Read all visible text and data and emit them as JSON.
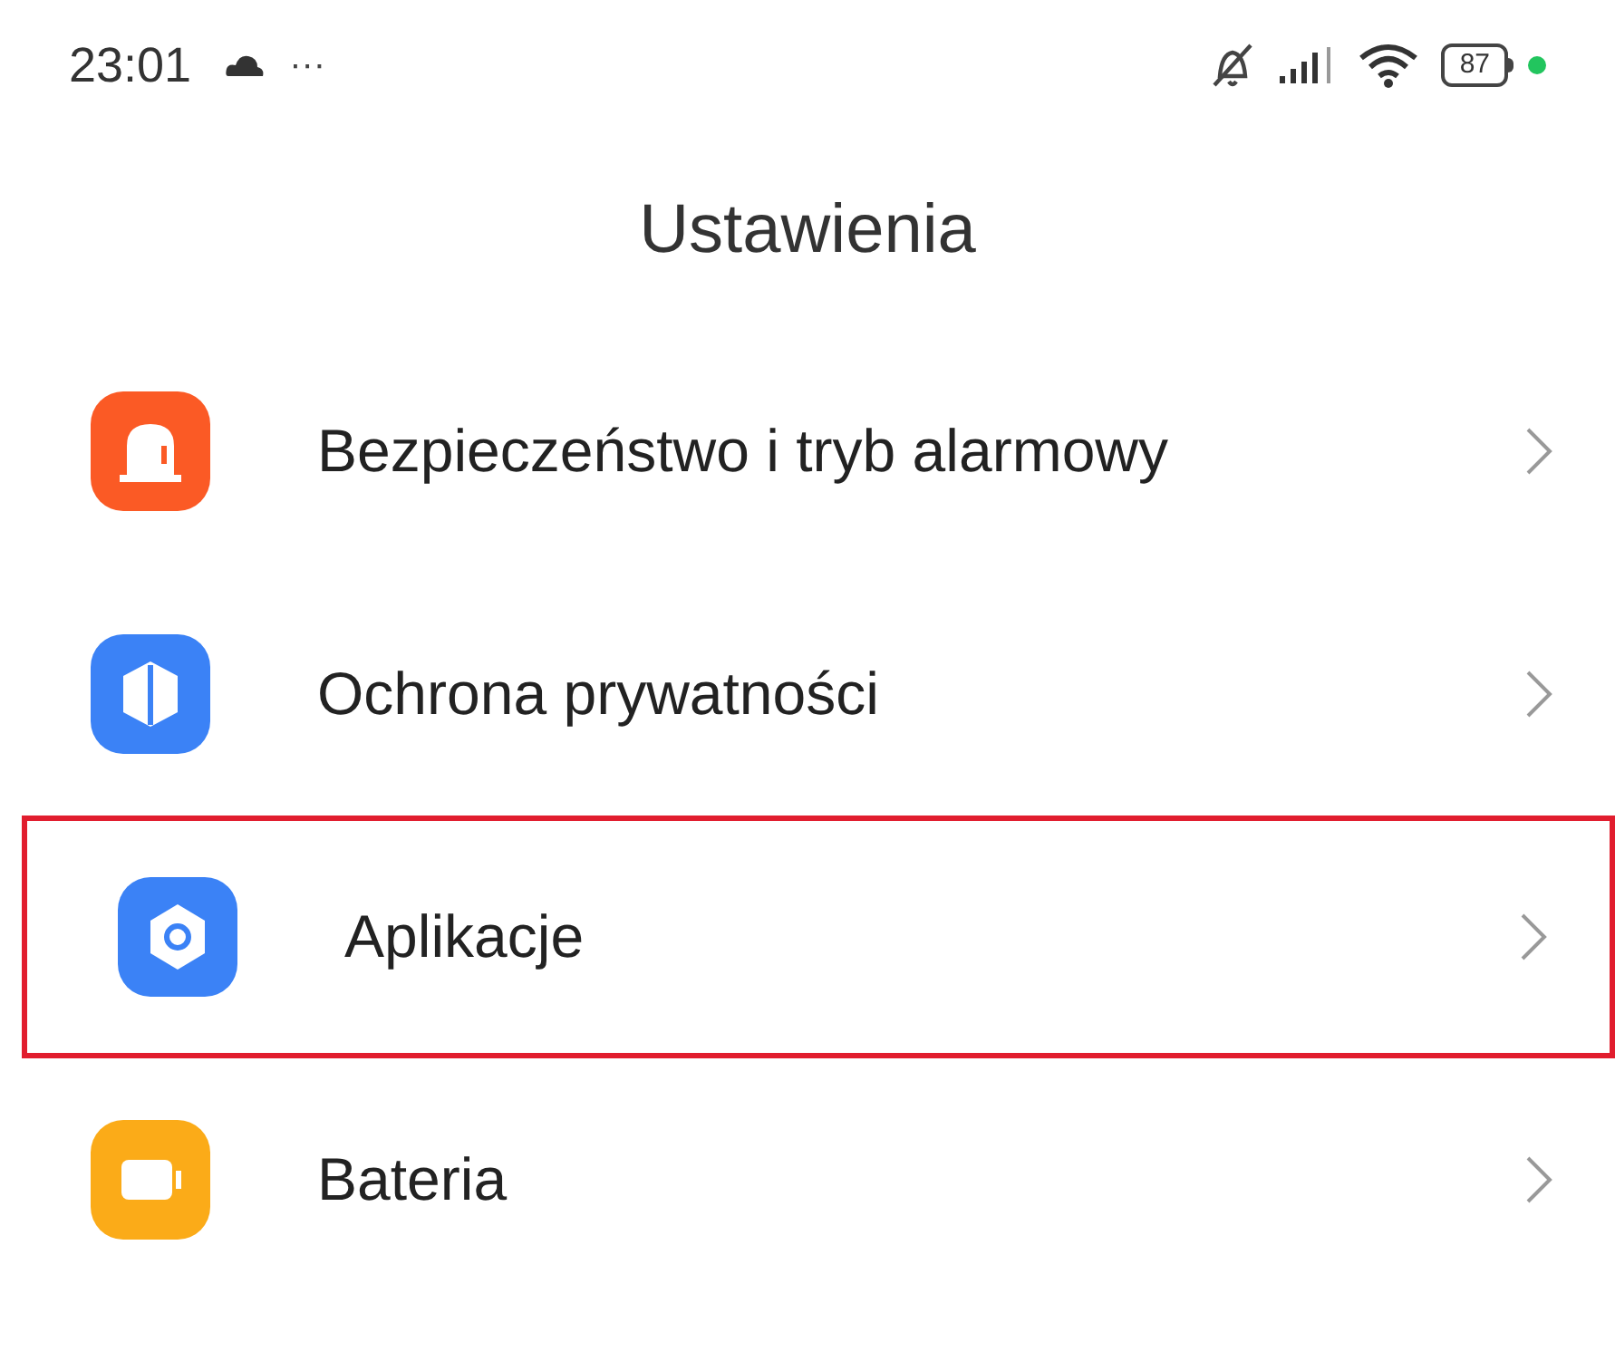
{
  "status_bar": {
    "time": "23:01",
    "more": "···",
    "battery": "87"
  },
  "title": "Ustawienia",
  "items": [
    {
      "label": "Bezpieczeństwo i tryb alarmowy",
      "kind": "alarm",
      "color": "#fb5a25",
      "highlighted": false
    },
    {
      "label": "Ochrona prywatności",
      "kind": "shield",
      "color": "#3b82f6",
      "highlighted": false
    },
    {
      "label": "Aplikacje",
      "kind": "hexagon",
      "color": "#3b82f6",
      "highlighted": true
    },
    {
      "label": "Bateria",
      "kind": "battery",
      "color": "#fbab18",
      "highlighted": false
    }
  ]
}
